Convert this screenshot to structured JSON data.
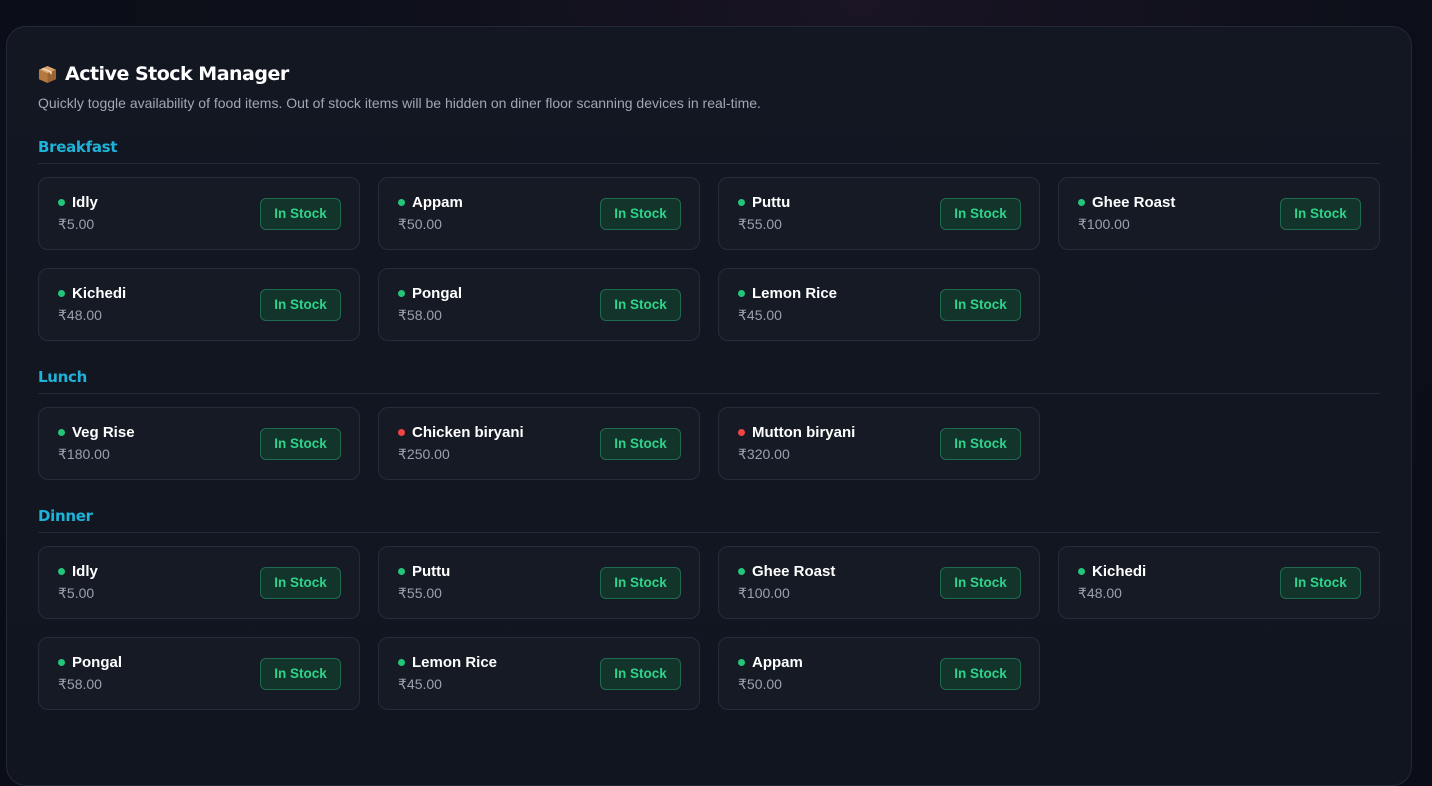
{
  "header": {
    "title": "Active Stock Manager",
    "icon": "package-box-icon",
    "subtitle": "Quickly toggle availability of food items. Out of stock items will be hidden on diner floor scanning devices in real-time."
  },
  "colors": {
    "accent": "#1fb2d8",
    "in_stock_text": "#2fd48b",
    "in_stock_bg": "#12342b",
    "dot_green": "#22c57a",
    "dot_red": "#ef4444"
  },
  "sections": [
    {
      "title": "Breakfast",
      "items": [
        {
          "name": "Idly",
          "price": "₹5.00",
          "status": "In Stock",
          "dot": "green"
        },
        {
          "name": "Appam",
          "price": "₹50.00",
          "status": "In Stock",
          "dot": "green"
        },
        {
          "name": "Puttu",
          "price": "₹55.00",
          "status": "In Stock",
          "dot": "green"
        },
        {
          "name": "Ghee Roast",
          "price": "₹100.00",
          "status": "In Stock",
          "dot": "green"
        },
        {
          "name": "Kichedi",
          "price": "₹48.00",
          "status": "In Stock",
          "dot": "green"
        },
        {
          "name": "Pongal",
          "price": "₹58.00",
          "status": "In Stock",
          "dot": "green"
        },
        {
          "name": "Lemon Rice",
          "price": "₹45.00",
          "status": "In Stock",
          "dot": "green"
        }
      ]
    },
    {
      "title": "Lunch",
      "items": [
        {
          "name": "Veg Rise",
          "price": "₹180.00",
          "status": "In Stock",
          "dot": "green"
        },
        {
          "name": "Chicken biryani",
          "price": "₹250.00",
          "status": "In Stock",
          "dot": "red"
        },
        {
          "name": "Mutton biryani",
          "price": "₹320.00",
          "status": "In Stock",
          "dot": "red"
        }
      ]
    },
    {
      "title": "Dinner",
      "items": [
        {
          "name": "Idly",
          "price": "₹5.00",
          "status": "In Stock",
          "dot": "green"
        },
        {
          "name": "Puttu",
          "price": "₹55.00",
          "status": "In Stock",
          "dot": "green"
        },
        {
          "name": "Ghee Roast",
          "price": "₹100.00",
          "status": "In Stock",
          "dot": "green"
        },
        {
          "name": "Kichedi",
          "price": "₹48.00",
          "status": "In Stock",
          "dot": "green"
        },
        {
          "name": "Pongal",
          "price": "₹58.00",
          "status": "In Stock",
          "dot": "green"
        },
        {
          "name": "Lemon Rice",
          "price": "₹45.00",
          "status": "In Stock",
          "dot": "green"
        },
        {
          "name": "Appam",
          "price": "₹50.00",
          "status": "In Stock",
          "dot": "green"
        }
      ]
    }
  ]
}
